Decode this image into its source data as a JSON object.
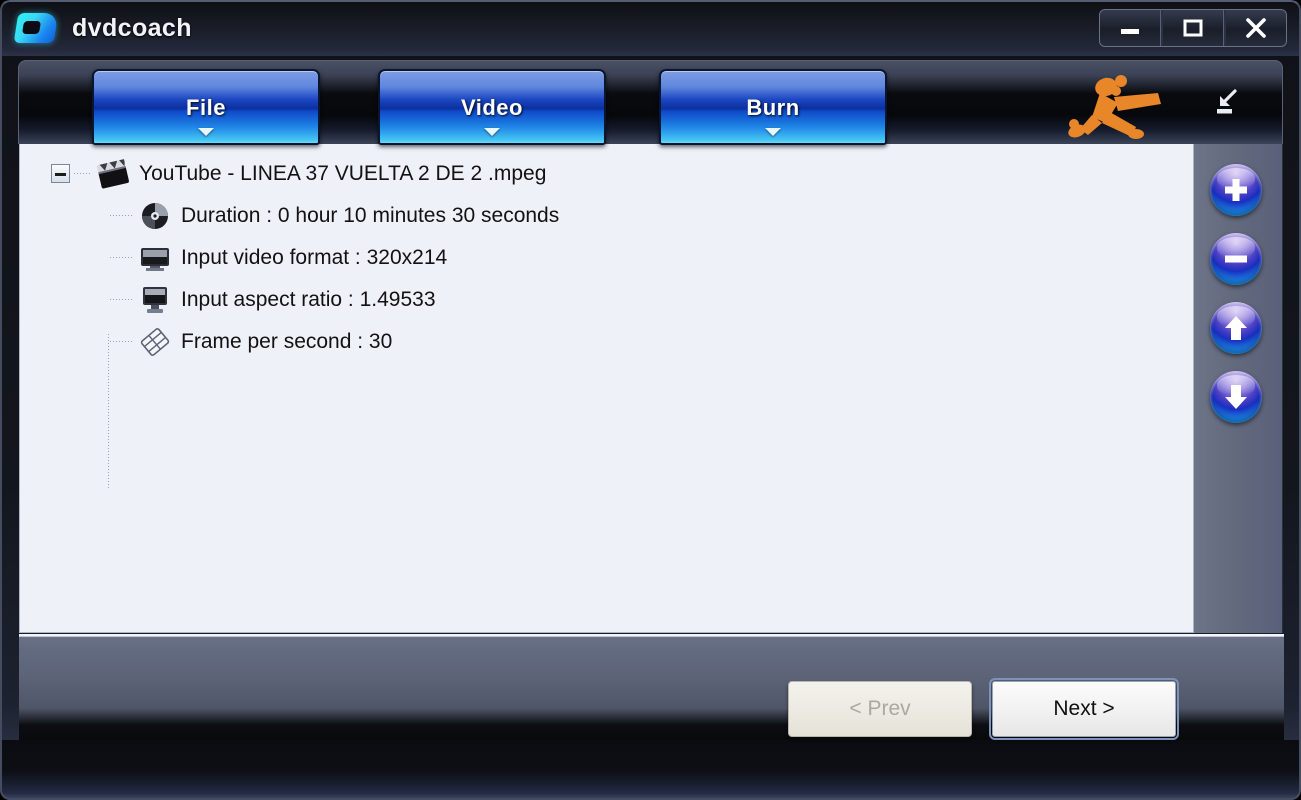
{
  "window": {
    "title": "dvdcoach",
    "logo_icon": "dvdcoach-logo-icon",
    "controls": [
      {
        "name": "minimize",
        "icon": "minimize-icon"
      },
      {
        "name": "maximize",
        "icon": "maximize-icon"
      },
      {
        "name": "close",
        "icon": "close-icon"
      }
    ]
  },
  "toolbar": {
    "tabs": [
      {
        "id": "file",
        "label": "File",
        "caret_icon": "chevron-down-icon",
        "active": true
      },
      {
        "id": "video",
        "label": "Video",
        "caret_icon": "chevron-down-icon",
        "active": false
      },
      {
        "id": "burn",
        "label": "Burn",
        "caret_icon": "chevron-down-icon",
        "active": false
      }
    ],
    "mascot_icon": "orange-runner-mascot-icon",
    "collapse_icon": "collapse-panel-icon"
  },
  "tree": {
    "root": {
      "expander_state": "expanded",
      "icon": "clapperboard-icon",
      "label": "YouTube - LINEA 37 VUELTA  2 DE 2 .mpeg"
    },
    "children": [
      {
        "icon": "disc-icon",
        "label": "Duration : 0 hour 10 minutes 30 seconds"
      },
      {
        "icon": "monitor-icon",
        "label": "Input video format : 320x214"
      },
      {
        "icon": "display-icon",
        "label": "Input aspect ratio : 1.49533"
      },
      {
        "icon": "film-frame-icon",
        "label": "Frame per second : 30"
      }
    ]
  },
  "side_rail": {
    "buttons": [
      {
        "id": "add",
        "icon": "plus-icon",
        "title": "Add"
      },
      {
        "id": "remove",
        "icon": "minus-icon",
        "title": "Remove"
      },
      {
        "id": "up",
        "icon": "arrow-up-icon",
        "title": "Move up"
      },
      {
        "id": "down",
        "icon": "arrow-down-icon",
        "title": "Move down"
      }
    ]
  },
  "footer": {
    "prev_label": "< Prev",
    "prev_enabled": false,
    "next_label": "Next >",
    "next_enabled": true
  },
  "colors": {
    "tab_blue": "#1b46c0",
    "accent_cyan": "#35e6f7",
    "mascot_orange": "#e8862a",
    "content_bg": "#eef1f8",
    "panel_slate": "#5d6478"
  }
}
